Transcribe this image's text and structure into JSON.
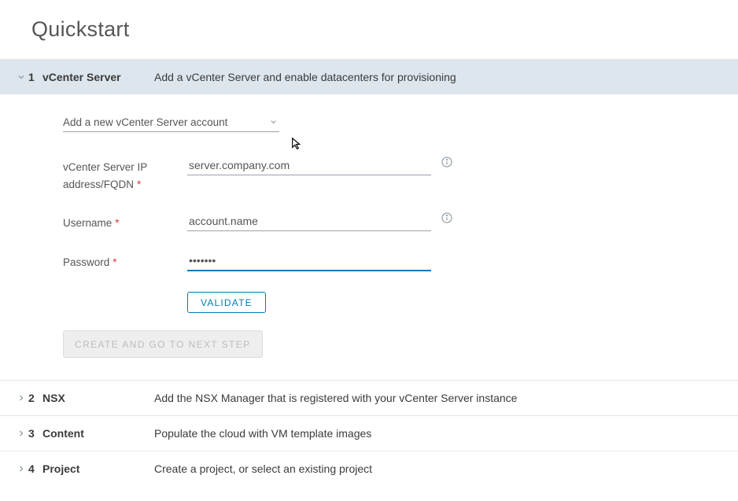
{
  "page": {
    "title": "Quickstart"
  },
  "steps": [
    {
      "num": "1",
      "title": "vCenter Server",
      "desc": "Add a vCenter Server and enable datacenters for provisioning"
    },
    {
      "num": "2",
      "title": "NSX",
      "desc": "Add the NSX Manager that is registered with your vCenter Server instance"
    },
    {
      "num": "3",
      "title": "Content",
      "desc": "Populate the cloud with VM template images"
    },
    {
      "num": "4",
      "title": "Project",
      "desc": "Create a project, or select an existing project"
    }
  ],
  "form": {
    "account_dropdown": "Add a new vCenter Server account",
    "ip_label": "vCenter Server IP address/FQDN",
    "ip_value": "server.company.com",
    "username_label": "Username",
    "username_value": "account.name",
    "password_label": "Password",
    "password_value": "•••••••",
    "validate_label": "Validate",
    "create_label": "Create and go to next step"
  }
}
